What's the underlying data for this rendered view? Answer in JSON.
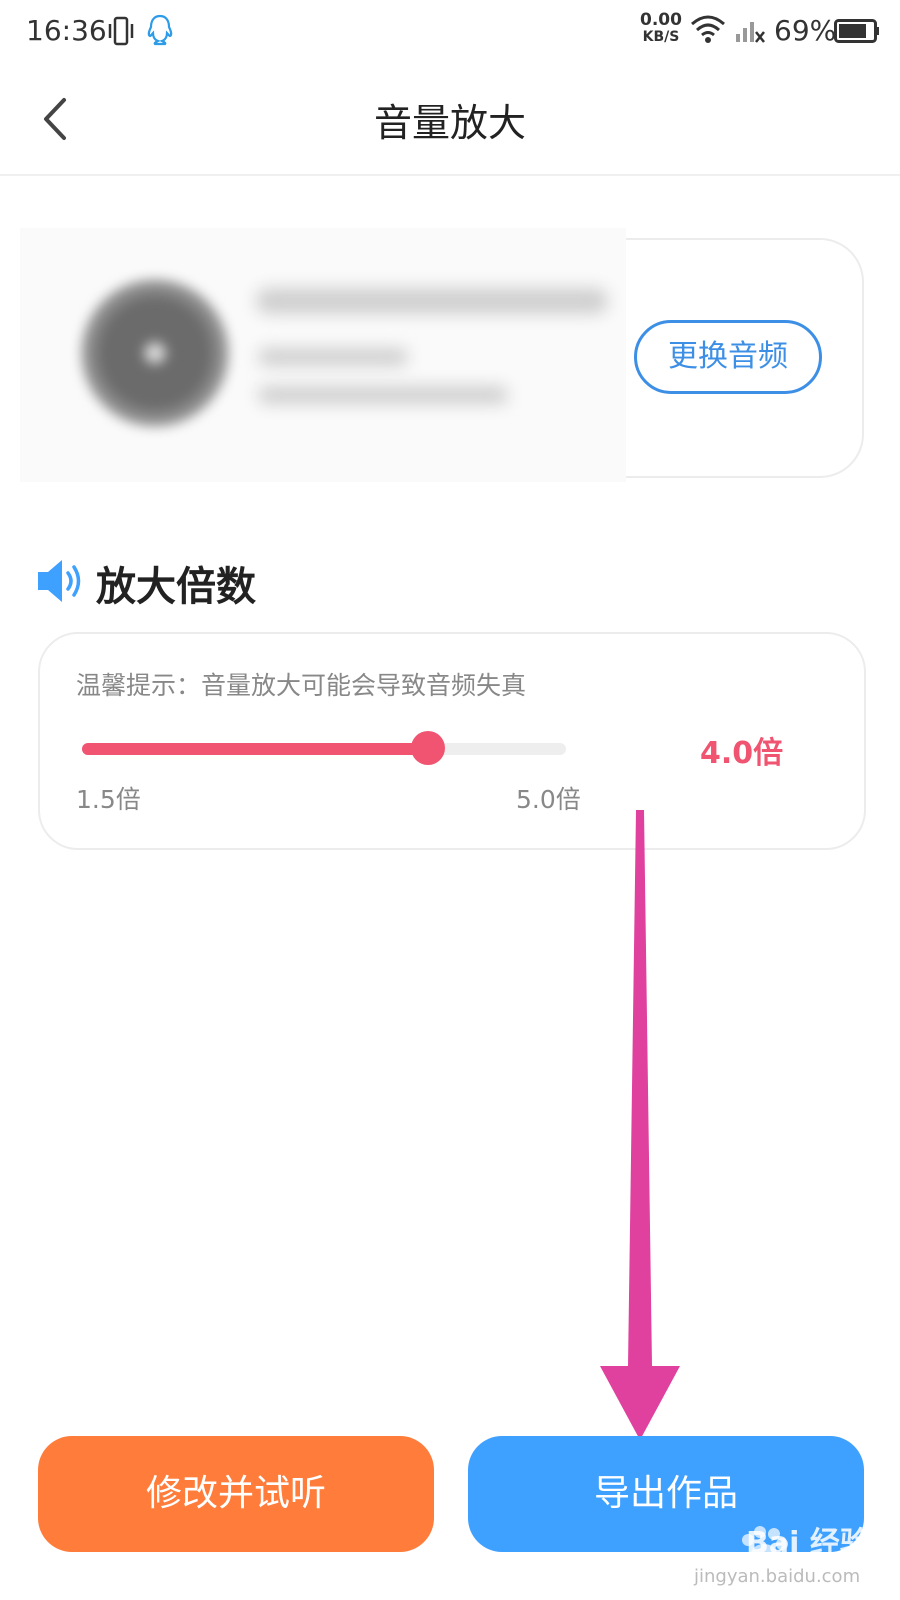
{
  "status_bar": {
    "time": "16:36",
    "net_speed_value": "0.00",
    "net_speed_unit": "KB/S",
    "battery_percent": "69%"
  },
  "header": {
    "title": "音量放大"
  },
  "audio_card": {
    "change_button_label": "更换音频"
  },
  "amplify": {
    "section_title": "放大倍数",
    "tip": "温馨提示：音量放大可能会导致音频失真",
    "min_label": "1.5倍",
    "max_label": "5.0倍",
    "value_label": "4.0倍",
    "min": 1.5,
    "max": 5.0,
    "value": 4.0
  },
  "actions": {
    "modify_label": "修改并试听",
    "export_label": "导出作品"
  },
  "watermark": {
    "brand": "Bai 经验",
    "url": "jingyan.baidu.com"
  },
  "colors": {
    "accent_blue": "#3d8fe6",
    "slider_pink": "#f05470",
    "button_orange": "#ff7c3a",
    "button_blue": "#3ea0ff",
    "annotation_magenta": "#e0409e"
  }
}
